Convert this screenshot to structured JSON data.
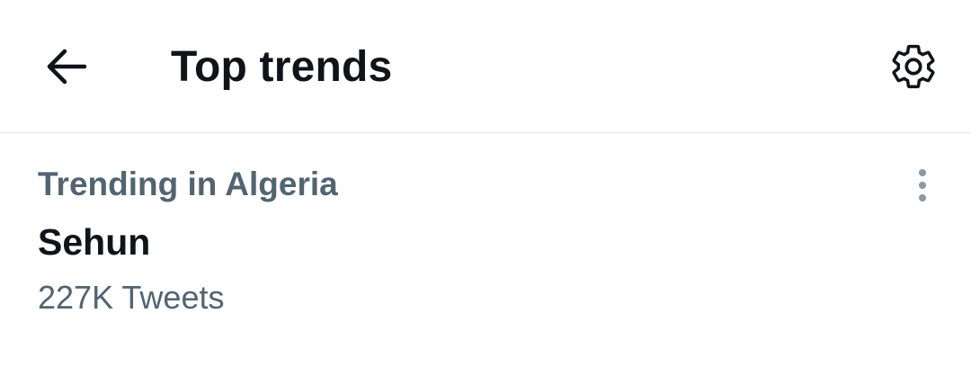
{
  "header": {
    "title": "Top trends",
    "back_icon": "arrow-left-icon",
    "settings_icon": "gear-icon"
  },
  "trends": [
    {
      "context": "Trending in Algeria",
      "name": "Sehun",
      "count": "227K Tweets",
      "more_icon": "more-vertical-icon"
    }
  ],
  "colors": {
    "primary_text": "#0f1419",
    "secondary_text": "#536471",
    "divider": "#e1e4e7",
    "more_dots": "#8b98a5"
  }
}
